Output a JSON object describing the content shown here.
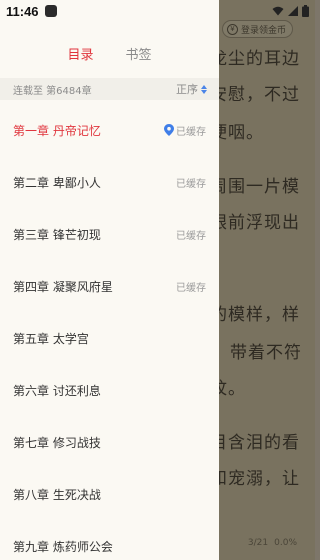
{
  "status_bar": {
    "time": "11:46"
  },
  "tabs": [
    {
      "label": "目录"
    },
    {
      "label": "书签"
    }
  ],
  "toc": {
    "update_text": "连载至 第6484章",
    "sort_label": "正序"
  },
  "chapters": [
    {
      "title": "第一章 丹帝记忆",
      "status": "已缓存"
    },
    {
      "title": "第二章 卑鄙小人",
      "status": "已缓存"
    },
    {
      "title": "第三章 锋芒初现",
      "status": "已缓存"
    },
    {
      "title": "第四章 凝聚风府星",
      "status": "已缓存"
    },
    {
      "title": "第五章 太学宫",
      "status": ""
    },
    {
      "title": "第六章 讨还利息",
      "status": ""
    },
    {
      "title": "第七章 修习战技",
      "status": ""
    },
    {
      "title": "第八章 生死决战",
      "status": ""
    },
    {
      "title": "第九章 炼药师公会",
      "status": ""
    }
  ],
  "reader": {
    "login_label": "登录领金币",
    "lines": [
      "龙尘的耳边",
      "安慰，不过",
      "哽咽。",
      "周围一片模",
      "眼前浮现出",
      "的模样，样",
      "带着不符",
      "纹。",
      "目含泪的看",
      "和宠溺，让"
    ],
    "page_progress": "3/21",
    "percent": "0.0%"
  },
  "colors": {
    "accent": "#e0343c",
    "sort_arrow": "#4a84e8",
    "drawer_bg": "#fbf9f3"
  }
}
